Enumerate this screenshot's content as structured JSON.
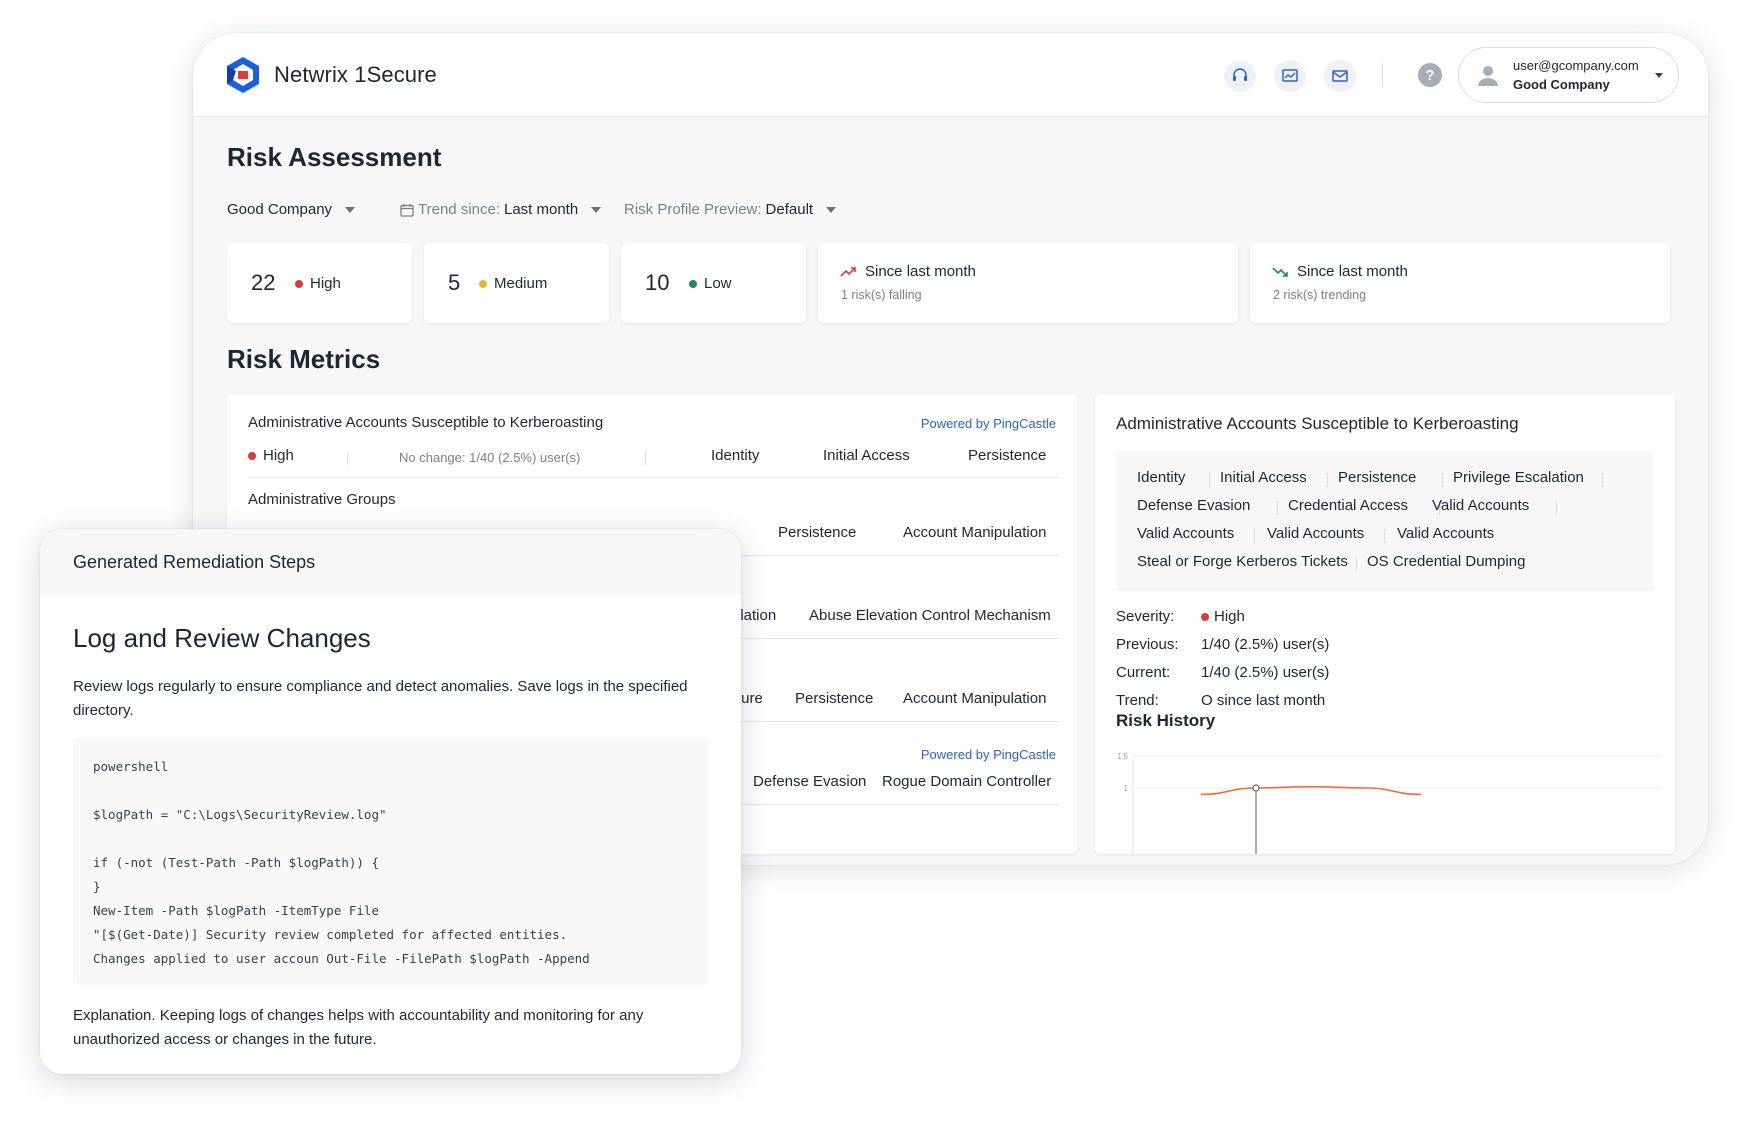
{
  "header": {
    "app_title": "Netwrix 1Secure",
    "logo_icon": "netwrix-logo-icon",
    "icons": [
      "support-icon",
      "reports-icon",
      "mail-icon",
      "help-icon"
    ],
    "help_glyph": "?",
    "user": {
      "email": "user@gcompany.com",
      "company": "Good Company"
    }
  },
  "risk_assessment": {
    "title": "Risk Assessment",
    "filters": {
      "organization": "Good Company",
      "trend_label": "Trend since:",
      "trend_value": "Last month",
      "profile_label": "Risk Profile Preview:",
      "profile_value": "Default"
    },
    "stats": [
      {
        "count": "22",
        "label": "High",
        "color": "#d93a3a"
      },
      {
        "count": "5",
        "label": "Medium",
        "color": "#f0b429"
      },
      {
        "count": "10",
        "label": "Low",
        "color": "#1f8a5b"
      }
    ],
    "trends": [
      {
        "title": "Since last month",
        "subtitle": "1 risk(s) falling",
        "icon": "trend-up-icon",
        "color": "#d93a3a"
      },
      {
        "title": "Since last month",
        "subtitle": "2 risk(s) trending",
        "icon": "trend-down-icon",
        "color": "#1f8a5b"
      }
    ]
  },
  "risk_metrics": {
    "title": "Risk Metrics",
    "metric1": {
      "title": "Administrative Accounts Susceptible to Kerberoasting",
      "powered_by": "Powered by PingCastle",
      "severity": "High",
      "change": "No change: 1/40 (2.5%) user(s)",
      "tags": [
        "Identity",
        "Initial Access",
        "Persistence"
      ]
    },
    "metric2": {
      "title": "Administrative Groups",
      "tags": [
        "Persistence",
        "Account Manipulation"
      ]
    },
    "metric3": {
      "tags": [
        "alation",
        "Abuse Elevation Control Mechanism"
      ]
    },
    "metric4": {
      "tags": [
        "ture",
        "Persistence",
        "Account Manipulation"
      ]
    },
    "metric5": {
      "powered_by": "Powered by PingCastle",
      "tags": [
        "Defense Evasion",
        "Rogue Domain Controller"
      ]
    }
  },
  "detail": {
    "title": "Administrative Accounts Susceptible to Kerberoasting",
    "tags": [
      "Identity",
      "Initial Access",
      "Persistence",
      "Privilege Escalation",
      "Defense Evasion",
      "Credential Access",
      "Valid Accounts",
      "Valid Accounts",
      "Valid Accounts",
      "Valid Accounts",
      "Steal or Forge Kerberos Tickets",
      "OS Credential Dumping"
    ],
    "severity_key": "Severity:",
    "severity_val": "High",
    "previous_key": "Previous:",
    "previous_val": "1/40 (2.5%) user(s)",
    "current_key": "Current:",
    "current_val": "1/40 (2.5%) user(s)",
    "trend_key": "Trend:",
    "trend_val": "O since last month",
    "risk_history_title": "Risk History"
  },
  "chart_data": {
    "type": "area",
    "title": "",
    "y_ticks": [
      "1.5",
      "1"
    ],
    "ylim": [
      0,
      1.5
    ],
    "series": [
      {
        "values": [
          0.9,
          1.0,
          1.02,
          1.0,
          0.9
        ]
      }
    ],
    "highlight_point_index": 1,
    "color": "#f26b3a"
  },
  "remediation": {
    "header": "Generated Remediation Steps",
    "title": "Log and Review Changes",
    "description": "Review logs regularly to ensure compliance and detect anomalies. Save logs in the specified directory.",
    "code": [
      "powershell",
      "",
      "$logPath = \"C:\\Logs\\SecurityReview.log\"",
      "",
      "if (-not (Test-Path -Path $logPath)) {",
      "}",
      "New-Item -Path $logPath -ItemType File",
      "\"[$(Get-Date)] Security review completed for affected entities.",
      "Changes applied to user accoun Out-File -FilePath $logPath -Append"
    ],
    "explanation": "Explanation. Keeping logs of changes helps with accountability and monitoring for any unauthorized access or changes in the future."
  }
}
